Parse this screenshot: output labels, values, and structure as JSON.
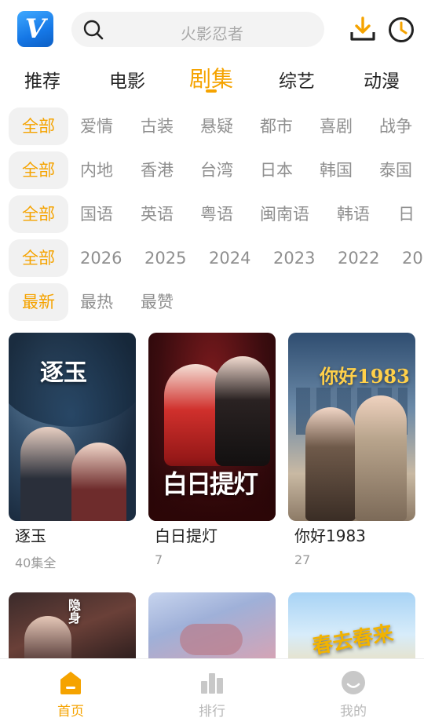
{
  "header": {
    "logo_letter": "V",
    "search": {
      "placeholder": "火影忍者"
    }
  },
  "tabs": [
    {
      "label": "推荐",
      "active": false
    },
    {
      "label": "电影",
      "active": false
    },
    {
      "label": "剧集",
      "active": true
    },
    {
      "label": "综艺",
      "active": false
    },
    {
      "label": "动漫",
      "active": false
    }
  ],
  "filters": {
    "genre": [
      "全部",
      "爱情",
      "古装",
      "悬疑",
      "都市",
      "喜剧",
      "战争"
    ],
    "region": [
      "全部",
      "内地",
      "香港",
      "台湾",
      "日本",
      "韩国",
      "泰国"
    ],
    "language": [
      "全部",
      "国语",
      "英语",
      "粤语",
      "闽南语",
      "韩语",
      "日"
    ],
    "year": [
      "全部",
      "2026",
      "2025",
      "2024",
      "2023",
      "2022",
      "20"
    ],
    "sort": [
      "最新",
      "最热",
      "最赞"
    ]
  },
  "cards": [
    {
      "title": "逐玉",
      "sub": "40集全",
      "poster_text": "逐玉"
    },
    {
      "title": "白日提灯",
      "sub": "7",
      "poster_text": "白日提灯"
    },
    {
      "title": "你好1983",
      "sub": "27",
      "poster_text": "你好1983"
    }
  ],
  "cards_row2_poster_text": [
    "隐身",
    "",
    "春去春来"
  ],
  "bottom_nav": [
    {
      "label": "首页",
      "icon": "home-icon",
      "active": true
    },
    {
      "label": "排行",
      "icon": "bar-chart-icon",
      "active": false
    },
    {
      "label": "我的",
      "icon": "smiley-icon",
      "active": false
    }
  ],
  "colors": {
    "accent": "#f5a300",
    "muted": "#8f8f8f",
    "chip_bg": "#f1f1f1"
  }
}
